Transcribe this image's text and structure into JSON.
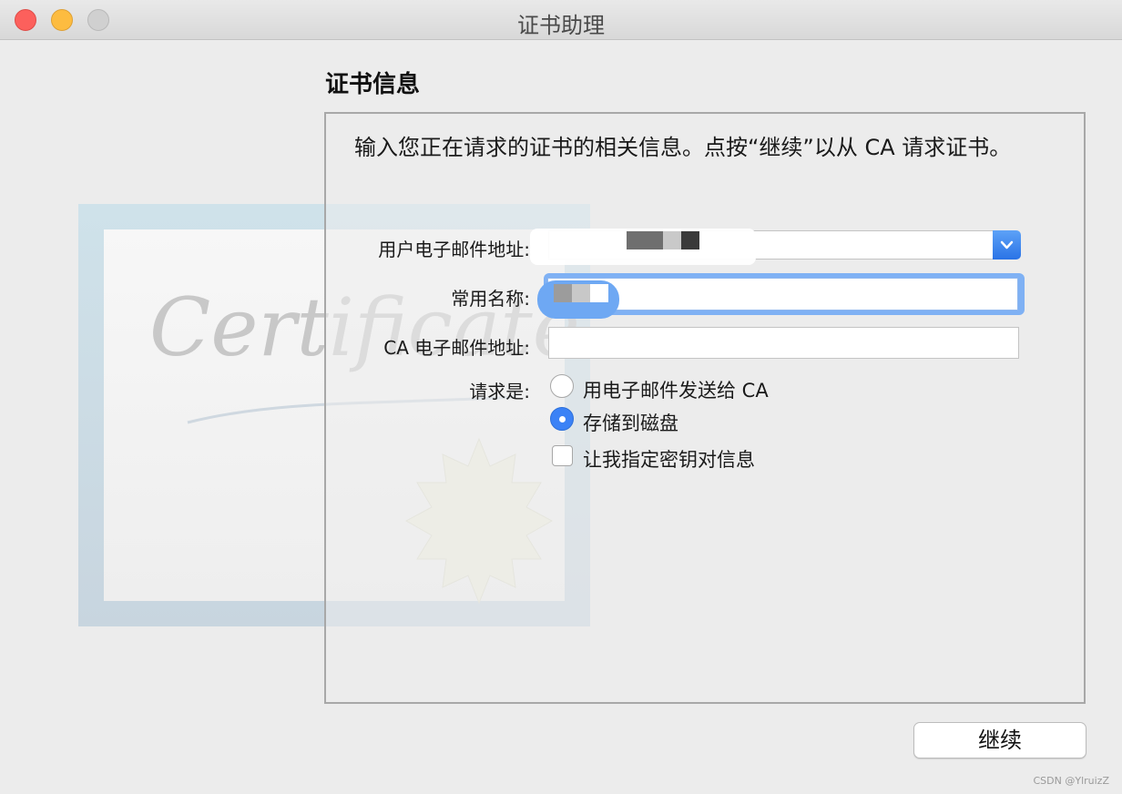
{
  "window": {
    "title": "证书助理",
    "buttons": [
      "close",
      "minimize",
      "zoom"
    ]
  },
  "heading": "证书信息",
  "intro_text": "输入您正在请求的证书的相关信息。点按“继续”以从 CA 请求证书。",
  "decoration": {
    "certificate_script": "Certificate"
  },
  "form": {
    "email_label": "用户电子邮件地址:",
    "email_value": "",
    "common_name_label": "常用名称:",
    "common_name_value": "",
    "ca_email_label": "CA 电子邮件地址:",
    "ca_email_value": "",
    "request_label": "请求是:",
    "request_options": [
      {
        "label": "用电子邮件发送给 CA",
        "selected": false
      },
      {
        "label": "存储到磁盘",
        "selected": true
      }
    ],
    "key_pair_checkbox": {
      "label": "让我指定密钥对信息",
      "checked": false
    }
  },
  "footer": {
    "continue_label": "继续"
  },
  "watermark": "CSDN @YlruizZ",
  "colors": {
    "accent": "#3b82f6",
    "close": "#fc605c",
    "minimize": "#fdbc40"
  }
}
